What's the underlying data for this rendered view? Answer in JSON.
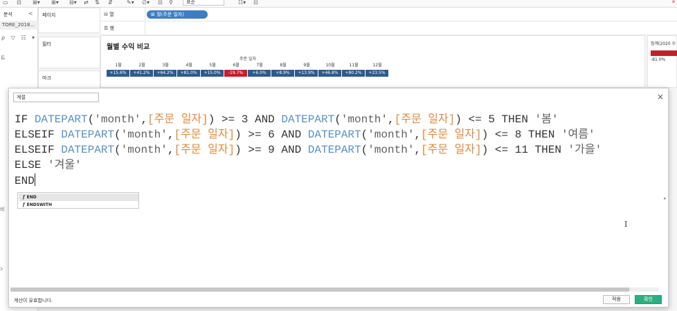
{
  "toolbar": {
    "format_select": "표준"
  },
  "left_panel": {
    "title": "분석",
    "collapse": "<",
    "data_source": "TORE_2018...",
    "tools": "ρ ▽ ☷ ▾",
    "side_mark_1": "트",
    "side_mark_2": "비",
    "side_mark_3": "ɔ"
  },
  "cards": {
    "pages": "페이지",
    "filters": "필터",
    "marks": "마크"
  },
  "shelves": {
    "columns_label": "iii 열",
    "rows_label": "☰ 행",
    "columns_pill": "⊞ 월(주문 일자)"
  },
  "viz": {
    "title": "월별 수익 비교",
    "axis_title": "주문 일자",
    "months": [
      "1월",
      "2월",
      "3월",
      "4월",
      "5월",
      "6월",
      "7월",
      "8월",
      "9월",
      "10월",
      "11월",
      "12월"
    ],
    "values": [
      "+15.6%",
      "+41.2%",
      "+64.2%",
      "+81.0%",
      "+15.0%",
      "-19.7%",
      "+6.0%",
      "+8.9%",
      "+13.9%",
      "+46.8%",
      "+80.2%",
      "+23.5%"
    ],
    "negative_color": "#c0222c",
    "positive_color": "#2e5b8e"
  },
  "legend": {
    "title": "집계(2020 수",
    "min_value": "-81.0%"
  },
  "dialog": {
    "calc_name": "계절",
    "close": "×",
    "code": {
      "line1": {
        "kw_if": "IF ",
        "fn1": "DATEPART",
        "p1": "(",
        "s1": "'month'",
        "c1": ",",
        "f1": "[주문 일자]",
        "op1": ") >= 3 AND ",
        "fn2": "DATEPART",
        "p2": "(",
        "s2": "'month'",
        "c2": ",",
        "f2": "[주문 일자]",
        "op2": ") <= 5 THEN ",
        "res": "'봄'"
      },
      "line2": {
        "kw": "ELSEIF ",
        "fn1": "DATEPART",
        "p1": "(",
        "s1": "'month'",
        "c1": ",",
        "f1": "[주문 일자]",
        "op1": ") >= 6 AND ",
        "fn2": "DATEPART",
        "p2": "(",
        "s2": "'month'",
        "c2": ",",
        "f2": "[주문 일자]",
        "op2": ") <= 8 THEN ",
        "res": "'여름'"
      },
      "line3": {
        "kw": "ELSEIF ",
        "fn1": "DATEPART",
        "p1": "(",
        "s1": "'month'",
        "c1": ",",
        "f1": "[주문 일자]",
        "op1": ") >= 9 AND ",
        "fn2": "DATEPART",
        "p2": "(",
        "s2": "'month'",
        "c2": ",",
        "f2": "[주문 일자]",
        "op2": ") <= 11 THEN ",
        "res": "'가을'"
      },
      "line4": {
        "kw": "ELSE ",
        "res": "'겨울'"
      },
      "line5": {
        "kw": "END"
      }
    },
    "autocomplete": [
      {
        "icon": "f",
        "label": "END"
      },
      {
        "icon": "f",
        "label": "ENDSWITH"
      }
    ],
    "status": "계산이 유효합니다.",
    "apply_label": "적용",
    "ok_label": "확인",
    "accent_color": "#2db081"
  }
}
